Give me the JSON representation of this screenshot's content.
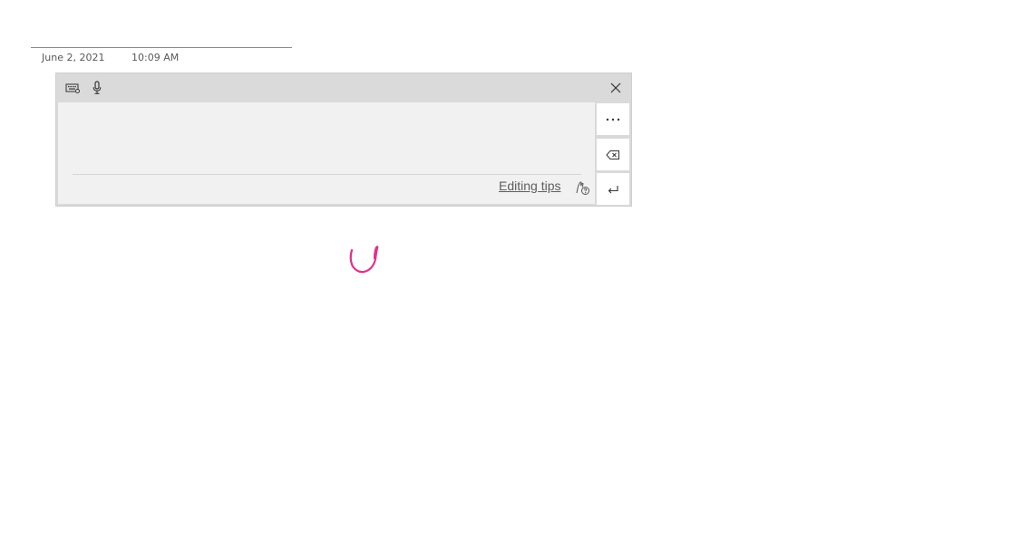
{
  "header": {
    "date": "June 2, 2021",
    "time": "10:09 AM"
  },
  "handwriting_panel": {
    "titlebar": {
      "icons": [
        "keyboard-icon",
        "microphone-icon",
        "close-icon"
      ]
    },
    "editing_tips_label": "Editing tips",
    "side_buttons": [
      "more-icon",
      "backspace-icon",
      "enter-icon"
    ]
  },
  "colors": {
    "panel_bg": "#dadada",
    "canvas_bg": "#f1f1f1",
    "ink": "#e3318c",
    "text_muted": "#5e5e5e"
  }
}
